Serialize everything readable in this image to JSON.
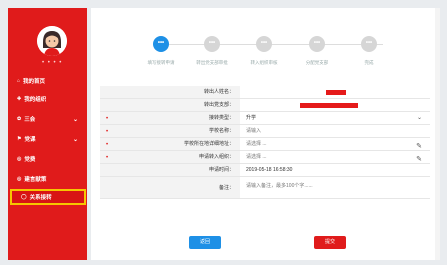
{
  "sidebar": {
    "dots": "• • • •",
    "items": [
      {
        "label": "我的首页",
        "icon": "home-icon",
        "glyph": "⌂"
      },
      {
        "label": "我的组织",
        "icon": "group-icon",
        "glyph": "✚"
      },
      {
        "label": "三会",
        "icon": "gear-icon",
        "glyph": "✿"
      },
      {
        "label": "党课",
        "icon": "flag-icon",
        "glyph": "⚑"
      },
      {
        "label": "党费",
        "icon": "badge-icon",
        "glyph": "◎"
      },
      {
        "label": "建言献策",
        "icon": "chat-icon",
        "glyph": "◎"
      },
      {
        "label": "关系接转",
        "icon": "transfer-icon",
        "glyph": "◯"
      }
    ]
  },
  "steps": [
    {
      "label": "填写接转申请"
    },
    {
      "label": "转出党支部审批"
    },
    {
      "label": "转入组织审核"
    },
    {
      "label": "分配党支部"
    },
    {
      "label": "完成"
    }
  ],
  "form": {
    "rows": [
      {
        "label": "转出人姓名：",
        "value": "",
        "required": false
      },
      {
        "label": "转出党支部：",
        "value": "",
        "required": false
      },
      {
        "label": "接转类型：",
        "value": "升学",
        "required": true
      },
      {
        "label": "学校名称：",
        "value": "请输入",
        "required": true
      },
      {
        "label": "学校所在地详细地址：",
        "value": "请选择 ...",
        "required": true
      },
      {
        "label": "申请转入组织：",
        "value": "请选择 ...",
        "required": true
      },
      {
        "label": "申请时间：",
        "value": "2019-05-18 16:58:30",
        "required": false
      },
      {
        "label": "备注：",
        "value": "请输入备注，最多100个字......",
        "required": false
      }
    ]
  },
  "buttons": {
    "back": "返回",
    "submit": "提交"
  },
  "colors": {
    "sidebar": "#e01b1b",
    "accent": "#1e90e6",
    "highlight": "#f6c600"
  }
}
